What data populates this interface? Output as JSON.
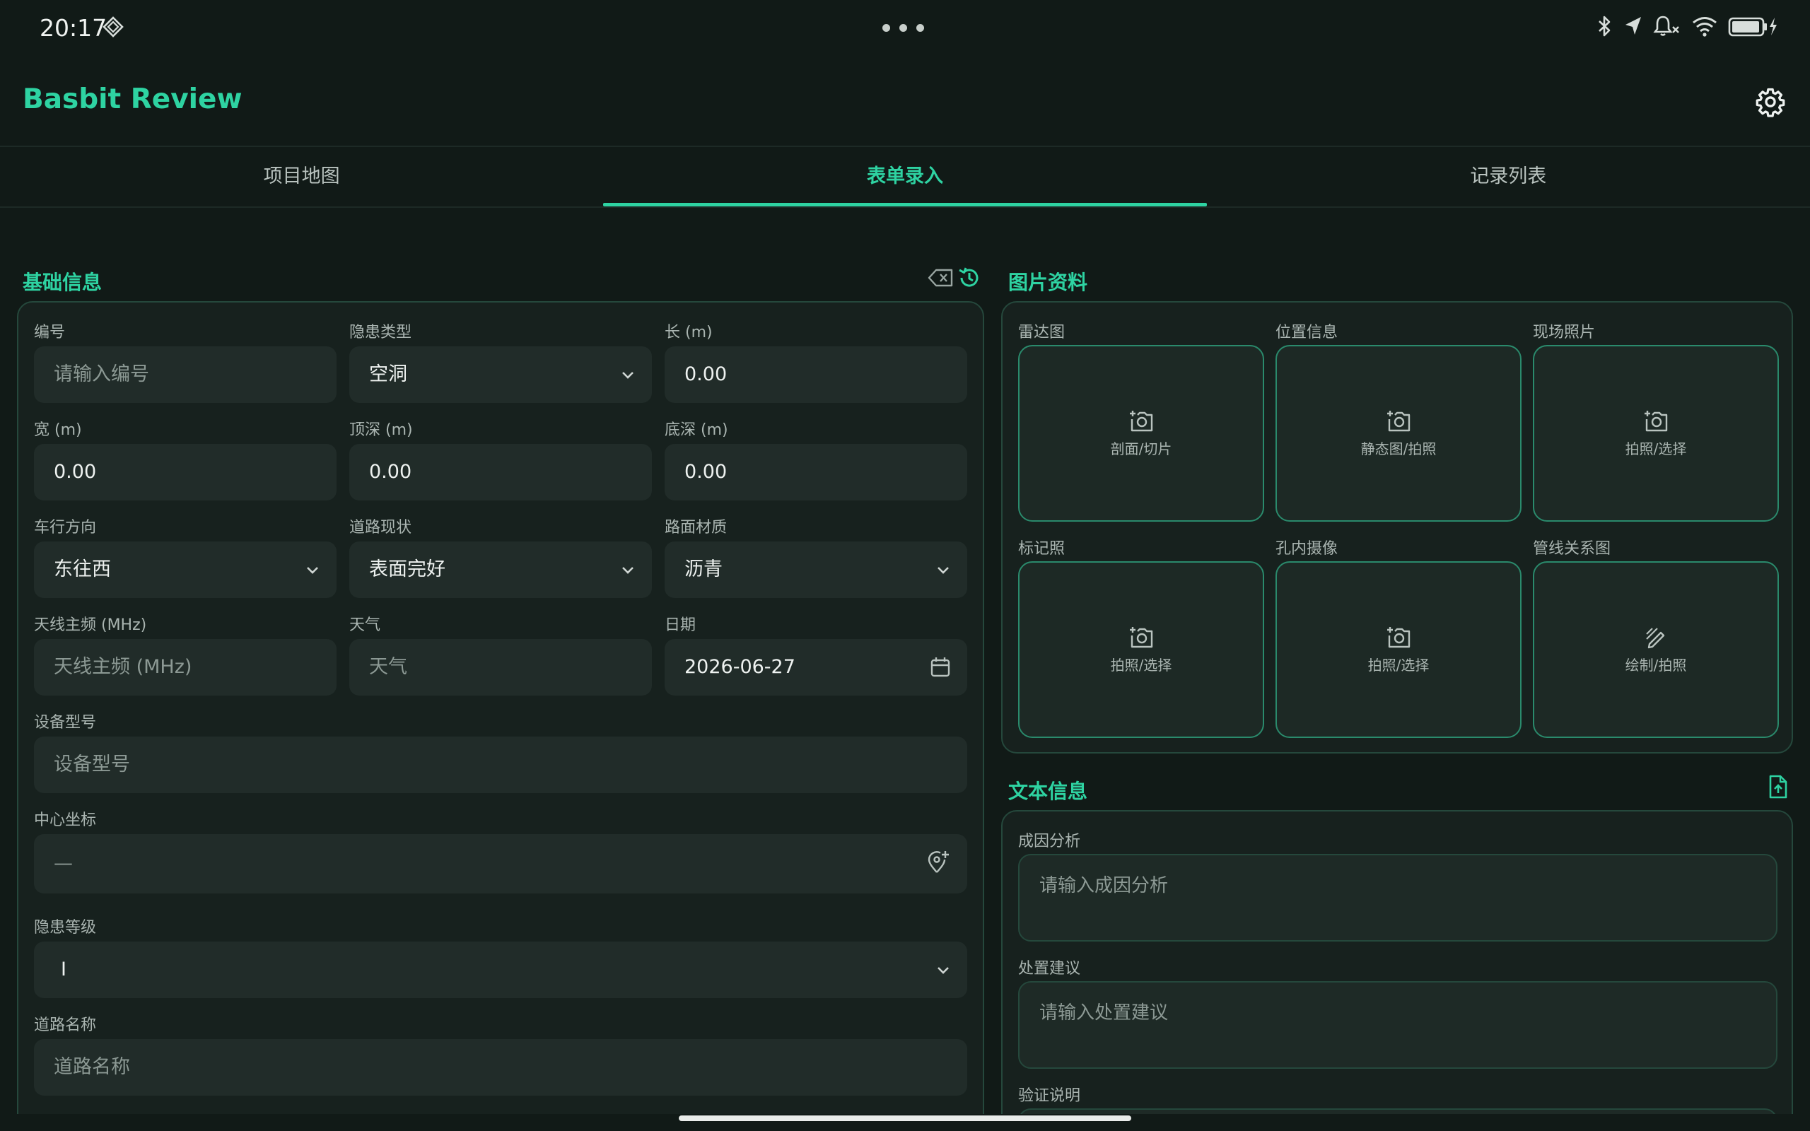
{
  "status_bar": {
    "time": "20:17",
    "icons": [
      "bluetooth-icon",
      "location-arrow-icon",
      "bell-muted-icon",
      "wifi-icon",
      "battery-charging-icon"
    ]
  },
  "app": {
    "title": "Basbit Review",
    "accent_color": "#2ed3a2"
  },
  "tabs": [
    {
      "label": "项目地图",
      "active": false
    },
    {
      "label": "表单录入",
      "active": true
    },
    {
      "label": "记录列表",
      "active": false
    }
  ],
  "basic_info": {
    "title": "基础信息",
    "fields": {
      "number": {
        "label": "编号",
        "placeholder": "请输入编号"
      },
      "hazard_type": {
        "label": "隐患类型",
        "value": "空洞"
      },
      "length": {
        "label": "长 (m)",
        "value": "0.00"
      },
      "width": {
        "label": "宽 (m)",
        "value": "0.00"
      },
      "top_depth": {
        "label": "顶深 (m)",
        "value": "0.00"
      },
      "bottom_depth": {
        "label": "底深 (m)",
        "value": "0.00"
      },
      "direction": {
        "label": "车行方向",
        "value": "东往西"
      },
      "road_status": {
        "label": "道路现状",
        "value": "表面完好"
      },
      "road_material": {
        "label": "路面材质",
        "value": "沥青"
      },
      "antenna_freq": {
        "label": "天线主频 (MHz)",
        "placeholder": "天线主频 (MHz)"
      },
      "weather": {
        "label": "天气",
        "placeholder": "天气"
      },
      "date": {
        "label": "日期",
        "value": "2026-06-27"
      },
      "device_model": {
        "label": "设备型号",
        "placeholder": "设备型号"
      },
      "center_coord": {
        "label": "中心坐标",
        "value": "—"
      },
      "hazard_level": {
        "label": "隐患等级",
        "value": "I"
      },
      "road_name": {
        "label": "道路名称",
        "placeholder": "道路名称"
      }
    }
  },
  "images": {
    "title": "图片资料",
    "tiles": [
      {
        "label": "雷达图",
        "action": "剖面/切片",
        "icon": "add-photo-icon"
      },
      {
        "label": "位置信息",
        "action": "静态图/拍照",
        "icon": "add-photo-icon"
      },
      {
        "label": "现场照片",
        "action": "拍照/选择",
        "icon": "add-photo-icon"
      },
      {
        "label": "标记照",
        "action": "拍照/选择",
        "icon": "add-photo-icon"
      },
      {
        "label": "孔内摄像",
        "action": "拍照/选择",
        "icon": "add-photo-icon"
      },
      {
        "label": "管线关系图",
        "action": "绘制/拍照",
        "icon": "draw-icon"
      }
    ]
  },
  "text_info": {
    "title": "文本信息",
    "fields": {
      "cause": {
        "label": "成因分析",
        "placeholder": "请输入成因分析"
      },
      "advice": {
        "label": "处置建议",
        "placeholder": "请输入处置建议"
      },
      "verify": {
        "label": "验证说明"
      }
    }
  }
}
